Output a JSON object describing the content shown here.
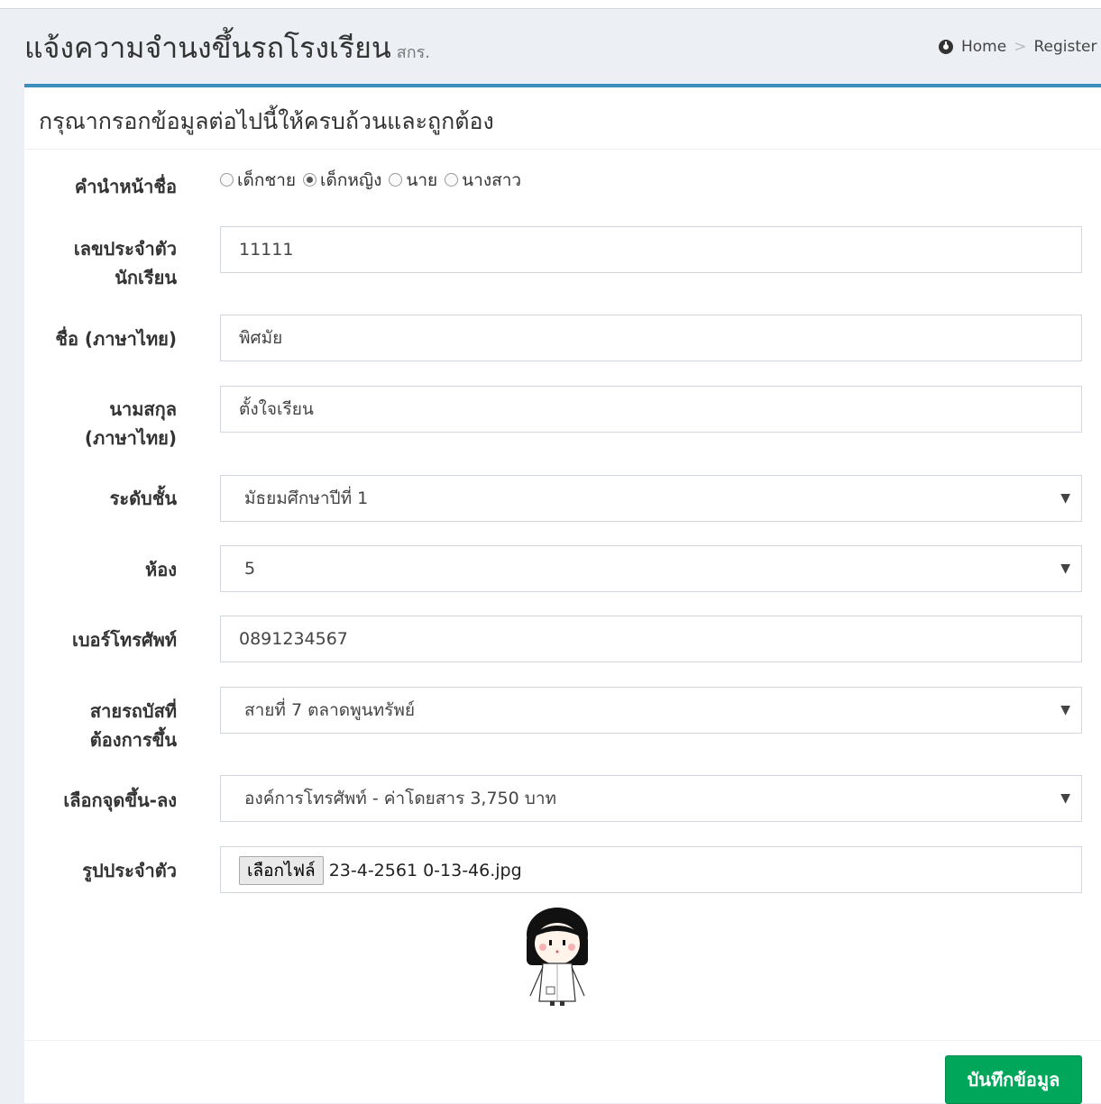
{
  "header": {
    "title": "แจ้งความจำนงขึ้นรถโรงเรียน",
    "subtitle": "สกร.",
    "breadcrumb": [
      "Home",
      "Register"
    ]
  },
  "form": {
    "title": "กรุณากรอกข้อมูลต่อไปนี้ให้ครบถ้วนและถูกต้อง",
    "prefix": {
      "label": "คำนำหน้าชื่อ",
      "options": [
        "เด็กชาย",
        "เด็กหญิง",
        "นาย",
        "นางสาว"
      ],
      "selected": "เด็กหญิง"
    },
    "student_id": {
      "label_line1": "เลขประจำตัว",
      "label_line2": "นักเรียน",
      "value": "11111"
    },
    "first_name": {
      "label": "ชื่อ (ภาษาไทย)",
      "value": "พิศมัย"
    },
    "last_name": {
      "label_line1": "นามสกุล",
      "label_line2": "(ภาษาไทย)",
      "value": "ตั้งใจเรียน"
    },
    "grade": {
      "label": "ระดับชั้น",
      "value": "มัธยมศึกษาปีที่ 1"
    },
    "room": {
      "label": "ห้อง",
      "value": "5"
    },
    "phone": {
      "label": "เบอร์โทรศัพท์",
      "value": "0891234567"
    },
    "bus_route": {
      "label_line1": "สายรถบัสที่",
      "label_line2": "ต้องการขึ้น",
      "value": "สายที่ 7 ตลาดพูนทรัพย์"
    },
    "stop": {
      "label": "เลือกจุดขึ้น-ลง",
      "value": "องค์การโทรศัพท์ - ค่าโดยสาร 3,750 บาท"
    },
    "photo": {
      "label": "รูปประจำตัว",
      "button": "เลือกไฟล์",
      "filename": "23-4-2561 0-13-46.jpg"
    },
    "submit": "บันทึกข้อมูล"
  },
  "colors": {
    "accent": "#3c8dbc",
    "save": "#00a65a",
    "background": "#ecf0f5"
  }
}
